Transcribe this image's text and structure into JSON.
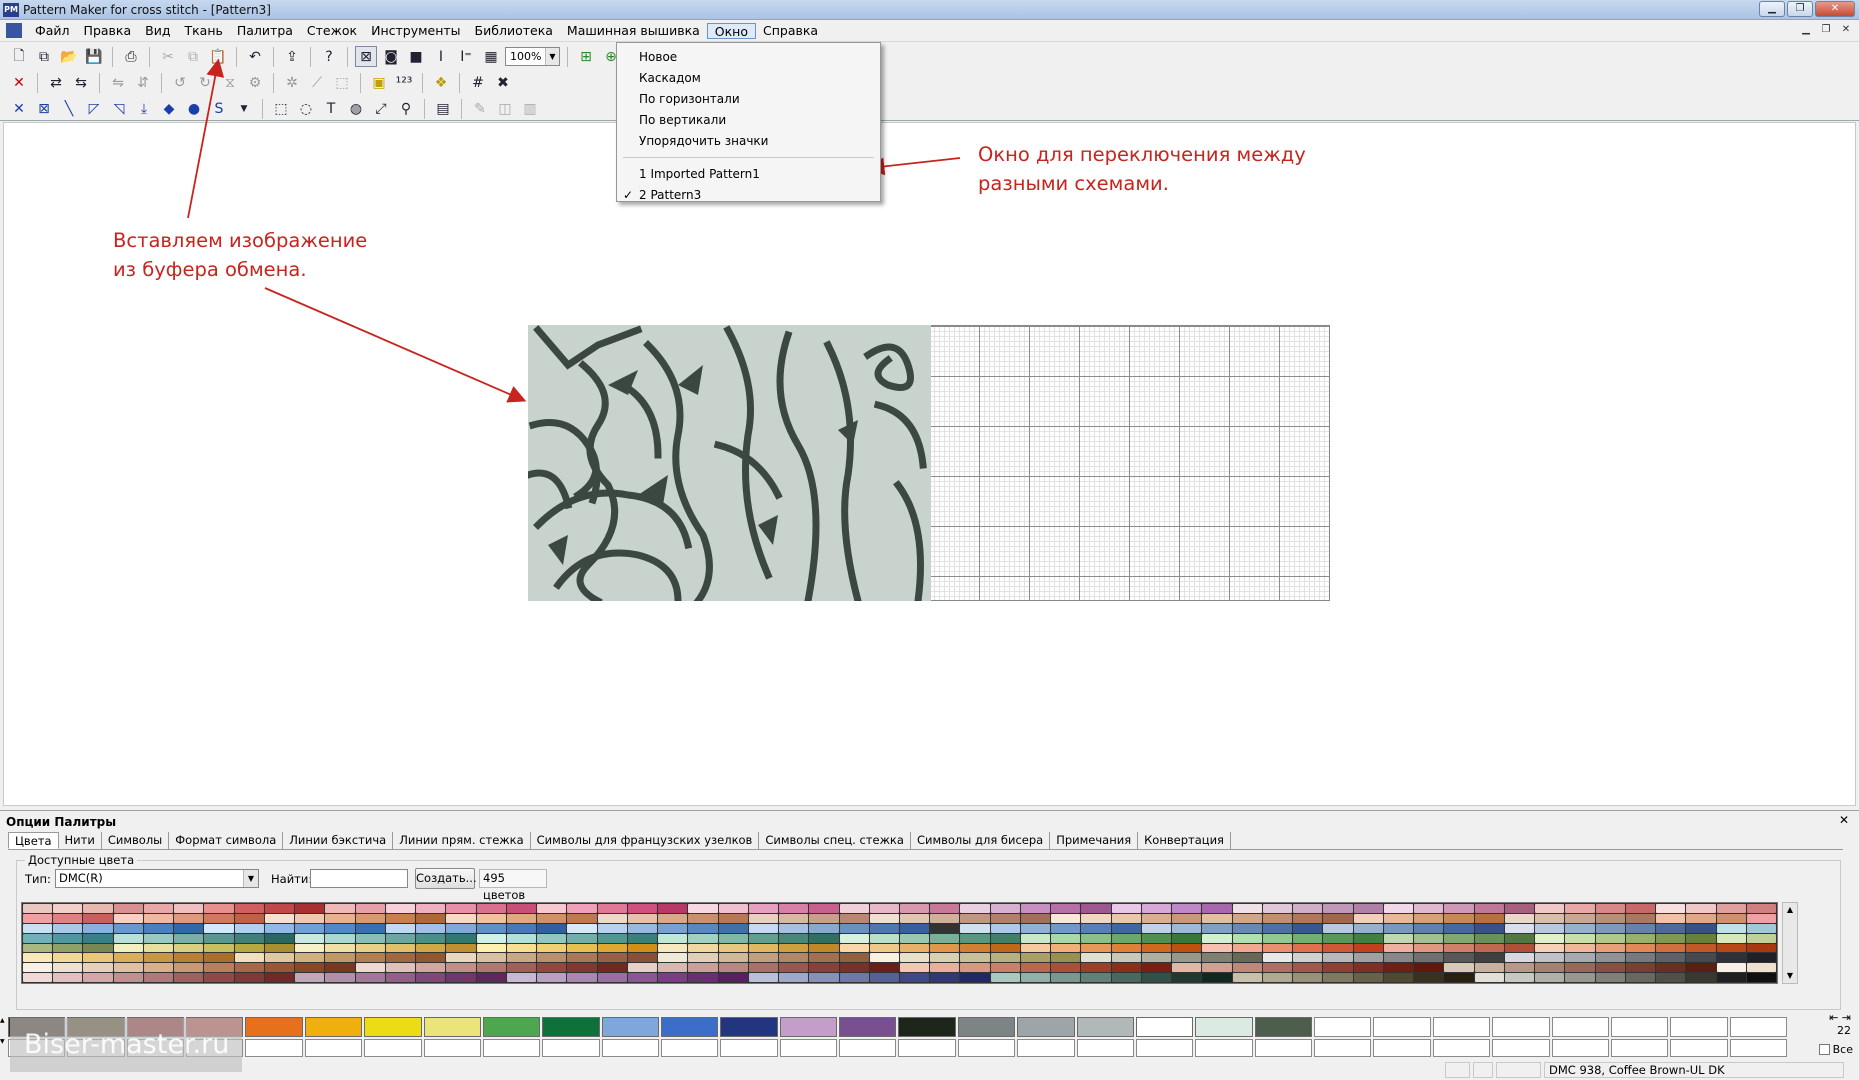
{
  "window": {
    "title": "Pattern Maker for cross stitch - [Pattern3]",
    "app_icon_text": "PM"
  },
  "menu": {
    "items": [
      "Файл",
      "Правка",
      "Вид",
      "Ткань",
      "Палитра",
      "Стежок",
      "Инструменты",
      "Библиотека",
      "Машинная вышивка",
      "Окно",
      "Справка"
    ],
    "active": "Окно"
  },
  "toolbar": {
    "zoom": "100%"
  },
  "window_menu": {
    "items": [
      "Новое",
      "Каскадом",
      "По горизонтали",
      "По вертикали",
      "Упорядочить значки"
    ],
    "windows": [
      {
        "label": "1 Imported Pattern1",
        "checked": false
      },
      {
        "label": "2 Pattern3",
        "checked": true
      }
    ]
  },
  "annotations": {
    "paste_note": "Вставляем изображение из буфера обмена.",
    "window_note": "Окно для переключения между разными схемами.",
    "color": "#c8241d"
  },
  "palette_panel": {
    "title": "Опции Палитры",
    "tabs": [
      "Цвета",
      "Нити",
      "Символы",
      "Формат символа",
      "Линии бэкстича",
      "Линии прям. стежка",
      "Символы для французских узелков",
      "Символы спец. стежка",
      "Символы для бисера",
      "Примечания",
      "Конвертация"
    ],
    "active_tab": "Цвета",
    "group_label": "Доступные цвета",
    "type_label": "Тип:",
    "type_value": "DMC(R)",
    "find_label": "Найти:",
    "find_value": "",
    "create_button": "Создать...",
    "color_count": "495 цветов",
    "palette_rows": [
      [
        "#e8c8c0",
        "#f0d0c8",
        "#e6b8b0",
        "#d89090",
        "#e8a8a8",
        "#f0c0c0",
        "#e89090",
        "#d06060",
        "#c04848",
        "#a83030",
        "#f0b8b8",
        "#e8a0a8",
        "#f8d0d8",
        "#f0b0c0",
        "#e890a8",
        "#d87090",
        "#c85078",
        "#f8c8d0",
        "#f0a0b8",
        "#e07898",
        "#d05080",
        "#b83868",
        "#f8d8e0",
        "#f0c0d0",
        "#e8a0c0",
        "#d880a8",
        "#c86090",
        "#f0d0d8",
        "#e8b8c8",
        "#d898b0",
        "#c87898",
        "#e8d0e0",
        "#d8b0d0",
        "#c890c0",
        "#b870a8",
        "#a05890",
        "#e8c8e8",
        "#d8a8d8",
        "#c088c8",
        "#a868b0",
        "#f0e0e8",
        "#e0c8d8",
        "#d0b0c8",
        "#c098b8",
        "#b080a8",
        "#f0d8e8",
        "#e0b8d0",
        "#d098b8",
        "#c07898",
        "#a86080",
        "#f0c8c8",
        "#e8a8a8",
        "#d88888",
        "#c86868",
        "#f8e0e0",
        "#f0c8c8",
        "#e0a0a0",
        "#d08080"
      ],
      [
        "#f0a0a0",
        "#e08080",
        "#c86060",
        "#f8d0c0",
        "#f0b8a0",
        "#e09880",
        "#d07860",
        "#c06048",
        "#f8e0d0",
        "#f0c8b0",
        "#e8b090",
        "#d89870",
        "#c88050",
        "#b06838",
        "#f8d8c0",
        "#f0c0a0",
        "#e0a880",
        "#d09068",
        "#c07850",
        "#f0d8c8",
        "#e8c0a8",
        "#d8a888",
        "#c89070",
        "#b87858",
        "#e8d0c0",
        "#d8b8a0",
        "#c8a088",
        "#b88870",
        "#f0e0d0",
        "#e0c8b0",
        "#d0b098",
        "#c09880",
        "#b08068",
        "#a07058",
        "#f8e8d8",
        "#f0d8c0",
        "#e8c8a8",
        "#d8b090",
        "#c89878",
        "#e0c0a0",
        "#d0a888",
        "#c09070",
        "#b07858",
        "#a06848",
        "#f0d0b8",
        "#e8b898",
        "#d8a078",
        "#c88858",
        "#b87040",
        "#e8d8c8",
        "#d8c0a8",
        "#c8a890",
        "#b89078",
        "#a87860",
        "#f0c0a8",
        "#e0a888",
        "#d09070"
      ],
      [
        "#c8e0f0",
        "#a8c8e8",
        "#88b0e0",
        "#6898d0",
        "#4880c0",
        "#3068a8",
        "#d0e8f8",
        "#b0d0f0",
        "#90b8e8",
        "#70a0d8",
        "#5088c8",
        "#3870b0",
        "#c0d8f0",
        "#a0c0e8",
        "#80a8d8",
        "#6090c8",
        "#4878b8",
        "#3060a0",
        "#d8e8f8",
        "#b8d0f0",
        "#98b8e0",
        "#78a0d0",
        "#5888c0",
        "#4070a8",
        "#c8d8f0",
        "#a8c0e0",
        "#88a8d0",
        "#6890c0",
        "#5078b0",
        "#3860a0",
        "#2848880",
        "#d0e0f0",
        "#b0c8e8",
        "#90b0d8",
        "#7098c8",
        "#5880b8",
        "#4068a0",
        "#c0d0e8",
        "#a0b8d8",
        "#80a0c8",
        "#6888b8",
        "#5070a8",
        "#3a5890",
        "#b8c8e0",
        "#98b0d0",
        "#7898c0",
        "#6080b0",
        "#4868a0",
        "#3a5088",
        "#d8e0f0",
        "#b8c8e0",
        "#98b0d0",
        "#8098c0",
        "#6880b0",
        "#5068a0",
        "#3a5088",
        "#c0e0e8",
        "#a0c8d8"
      ],
      [
        "#70b0b8",
        "#5098a0",
        "#388088",
        "#b8e0d8",
        "#98c8c0",
        "#78b0a8",
        "#589890",
        "#408078",
        "#286860",
        "#c8e8e0",
        "#a8d8d0",
        "#88c0b8",
        "#68a8a0",
        "#489088",
        "#307870",
        "#d0f0e8",
        "#b0e0d8",
        "#90c8c0",
        "#70b0a8",
        "#509890",
        "#388078",
        "#c0e8d8",
        "#a0d0c0",
        "#80b8a8",
        "#60a090",
        "#488878",
        "#307060",
        "#d8f0e0",
        "#b8e0c8",
        "#98c8b0",
        "#78b098",
        "#589880",
        "#408068",
        "#c8e8c8",
        "#a8d8a8",
        "#88c088",
        "#68a868",
        "#509050",
        "#387838",
        "#d0f0d0",
        "#b0e0b0",
        "#90c890",
        "#70b070",
        "#589858",
        "#408040",
        "#c0d8b0",
        "#a0c090",
        "#80a870",
        "#689058",
        "#507840",
        "#e0f0c8",
        "#c8e0a8",
        "#b0c888",
        "#98b068",
        "#809850",
        "#688038",
        "#d8e8b8",
        "#c0d098"
      ],
      [
        "#a8b880",
        "#90a068",
        "#788850",
        "#f0f0c0",
        "#e8e0a0",
        "#d8d080",
        "#c8c060",
        "#b8a840",
        "#a89030",
        "#f8f0c8",
        "#f0e0a8",
        "#e8d088",
        "#e0c068",
        "#d0a848",
        "#c09030",
        "#fff0b0",
        "#f8e090",
        "#f0d070",
        "#e8c050",
        "#e0a830",
        "#d09018",
        "#f8e8c0",
        "#f0d8a0",
        "#e8c880",
        "#e0b860",
        "#d0a040",
        "#c08828",
        "#f8d8a8",
        "#f0c888",
        "#e8b068",
        "#e09848",
        "#d08030",
        "#c06818",
        "#f8c8a0",
        "#f0b078",
        "#e89858",
        "#e08038",
        "#d06820",
        "#c05010",
        "#f8c0b0",
        "#f0a890",
        "#e89070",
        "#e07050",
        "#d05838",
        "#c04020",
        "#f0b0a0",
        "#e09880",
        "#d08068",
        "#c06850",
        "#b05038",
        "#f8d0b8",
        "#f0b898",
        "#e8a078",
        "#e08858",
        "#d07040",
        "#c05828",
        "#b84818",
        "#a83810"
      ],
      [
        "#f8e8b8",
        "#f0d898",
        "#e8c878",
        "#d8b058",
        "#c89840",
        "#b88030",
        "#a87028",
        "#f0e0c0",
        "#e0c8a0",
        "#d0b080",
        "#c09868",
        "#b08050",
        "#a06840",
        "#905830",
        "#e8d8c0",
        "#d8c0a0",
        "#c8a888",
        "#b89070",
        "#a87858",
        "#986048",
        "#885038",
        "#f0e8d8",
        "#e0d0b8",
        "#d0b898",
        "#c0a080",
        "#b08868",
        "#a07050",
        "#906040",
        "#f8f0e0",
        "#e8e0c8",
        "#d8d0b0",
        "#c8c098",
        "#b8b080",
        "#a8a068",
        "#989050",
        "#e0e0d0",
        "#c8c8b8",
        "#b0b0a0",
        "#989888",
        "#808070",
        "#686858",
        "#e8e8e8",
        "#d0d0d0",
        "#b8b8b8",
        "#a0a0a0",
        "#888888",
        "#707070",
        "#585858",
        "#404040",
        "#d8d8e0",
        "#c0c0c8",
        "#a8a8b0",
        "#909098",
        "#787880",
        "#606068",
        "#484850",
        "#303038",
        "#202028"
      ],
      [
        "#f8f0e8",
        "#f0e0d0",
        "#e8d0b8",
        "#e0c0a0",
        "#d8b088",
        "#c89870",
        "#b88058",
        "#a86848",
        "#985838",
        "#884828",
        "#783820",
        "#f0d8d0",
        "#e0c0b8",
        "#d0a8a0",
        "#c09088",
        "#b07870",
        "#a06058",
        "#904840",
        "#803830",
        "#702820",
        "#e8d0c8",
        "#d8b8b0",
        "#c8a098",
        "#b88880",
        "#a87068",
        "#985850",
        "#884038",
        "#783028",
        "#682018",
        "#f0c8b0",
        "#e8b098",
        "#d89880",
        "#c88068",
        "#b86850",
        "#a85038",
        "#984028",
        "#883018",
        "#782010",
        "#e0b8a8",
        "#d0a090",
        "#c08878",
        "#b07060",
        "#a05848",
        "#904030",
        "#803020",
        "#702010",
        "#601808",
        "#d8c8b8",
        "#c8b0a0",
        "#b89888",
        "#a88070",
        "#986858",
        "#885040",
        "#784030",
        "#683020",
        "#582010"
      ],
      [
        "#f0d8d8",
        "#e0c0c0",
        "#d0a8a8",
        "#c09090",
        "#b07878",
        "#a06060",
        "#904848",
        "#803838",
        "#702828",
        "#c0a8b8",
        "#b090a8",
        "#a07898",
        "#906088",
        "#804878",
        "#703868",
        "#602858",
        "#c8b8d0",
        "#b8a0c0",
        "#a888b0",
        "#9870a0",
        "#885890",
        "#784080",
        "#683070",
        "#582060",
        "#b8c0d8",
        "#a0a8c8",
        "#8890b8",
        "#7078a8",
        "#586098",
        "#404888",
        "#303878",
        "#202868",
        "#a8c8c0",
        "#90b0a8",
        "#789890",
        "#608078",
        "#486860",
        "#305048",
        "#203830",
        "#102820",
        "#c8c0a8",
        "#b0a890",
        "#989078",
        "#807860",
        "#686048",
        "#504830",
        "#383020",
        "#282010",
        "#e0e0d8",
        "#c8c8c0",
        "#b0b0a8",
        "#989890",
        "#808078",
        "#686860",
        "#505048",
        "#383830",
        "#202020",
        "#101010"
      ]
    ],
    "used_colors": [
      "#2e2215",
      "#4e3a1c",
      "#8e1f22",
      "#b9433a",
      "#e6701b",
      "#efb00f",
      "#ecdc16",
      "#eae47a",
      "#4ea64f",
      "#0e7139",
      "#7fa7dc",
      "#3c6ec9",
      "#22367f",
      "#c59dcb",
      "#7a4f91",
      "#1e261c",
      "#7d8486",
      "#9ea5a8",
      "#b0b8b8",
      "#ffffff",
      "#dcebe2",
      "#4e5e4d"
    ],
    "used_blank_count": 8,
    "nav_label": "22",
    "all_label": "Все"
  },
  "status_bar": {
    "color_name": "DMC  938, Coffee Brown-UL DK"
  },
  "watermark": "Biser-master.ru"
}
